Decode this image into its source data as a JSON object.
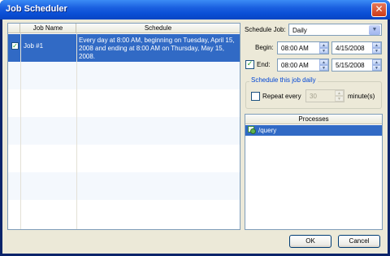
{
  "window": {
    "title": "Job Scheduler",
    "close_glyph": "✕"
  },
  "job_list": {
    "columns": [
      "Job Name",
      "Schedule"
    ],
    "rows": [
      {
        "checked": true,
        "name": "Job #1",
        "schedule": "Every day at 8:00 AM, beginning on Tuesday, April 15, 2008 and ending at 8:00 AM on Thursday, May 15, 2008."
      }
    ]
  },
  "schedule": {
    "schedule_job_label": "Schedule Job:",
    "schedule_job_value": "Daily",
    "begin_label": "Begin:",
    "begin_time": "08:00 AM",
    "begin_date": "4/15/2008",
    "end_label": "End:",
    "end_checked": true,
    "end_time": "08:00 AM",
    "end_date": "5/15/2008",
    "group_title": "Schedule this job daily",
    "repeat_label": "Repeat every",
    "repeat_checked": false,
    "repeat_value": "30",
    "repeat_unit": "minute(s)"
  },
  "processes": {
    "header": "Processes",
    "items": [
      {
        "label": "/query",
        "icon": "query-process-icon"
      }
    ]
  },
  "buttons": {
    "ok": "OK",
    "cancel": "Cancel"
  },
  "colors": {
    "selection": "#316ac5",
    "group_title": "#0046d5",
    "titlebar": "#0a4fd6"
  }
}
